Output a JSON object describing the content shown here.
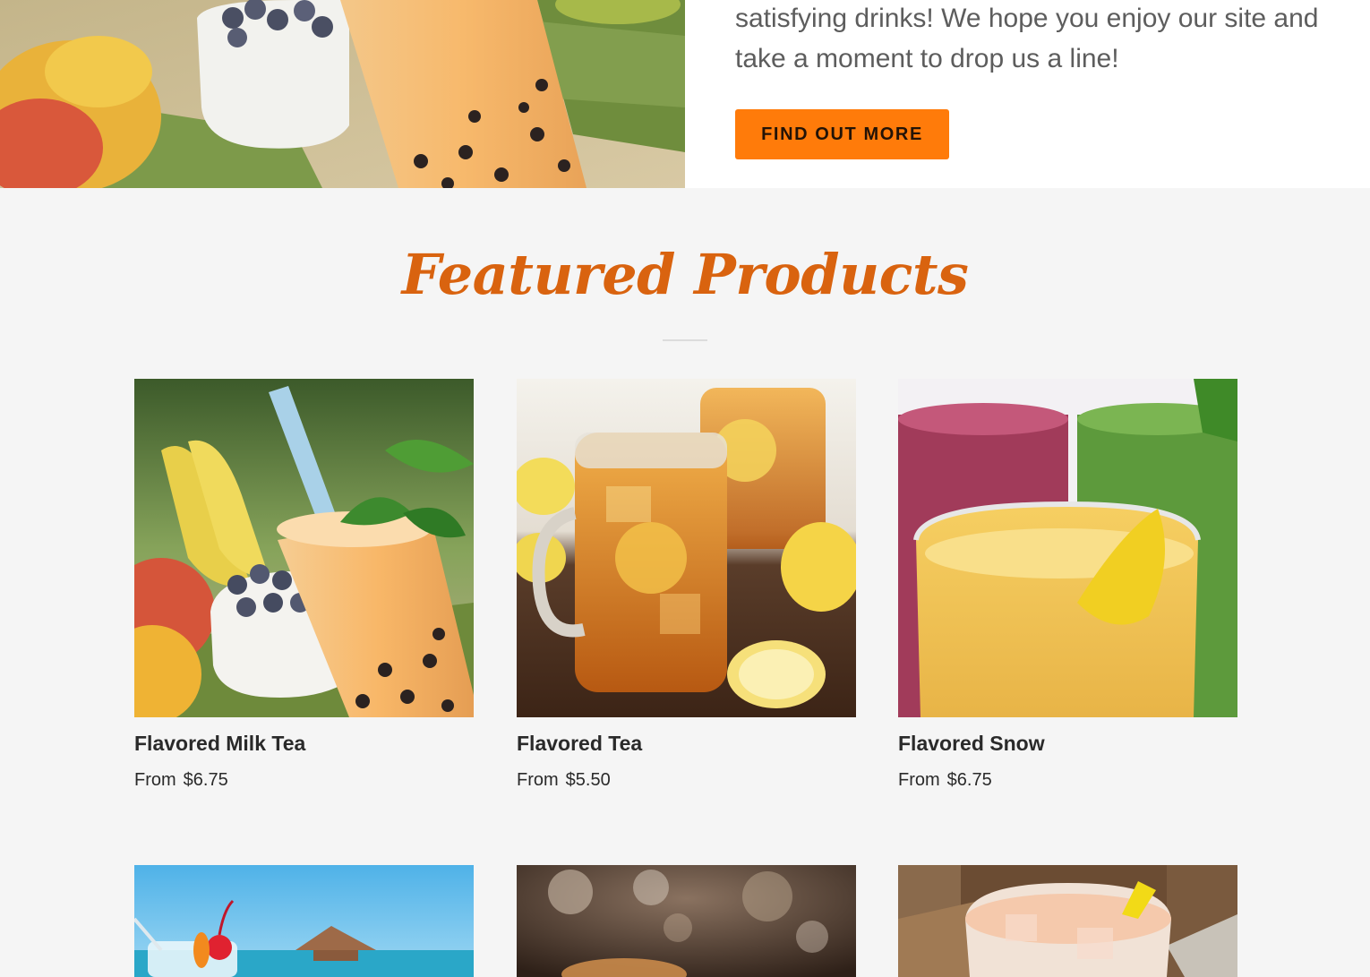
{
  "hero": {
    "copy_line_1": "satisfying drinks! We hope you enjoy our site and",
    "copy_line_2": "take a moment to drop us a line!",
    "cta_label": "FIND OUT MORE",
    "accent_color": "#ff7b0a"
  },
  "featured": {
    "title": "Featured Products",
    "title_color": "#d9630f",
    "products": [
      {
        "name": "Flavored Milk Tea",
        "price_prefix": "From",
        "price": "$6.75",
        "image": "milk-tea-photo"
      },
      {
        "name": "Flavored Tea",
        "price_prefix": "From",
        "price": "$5.50",
        "image": "iced-tea-photo"
      },
      {
        "name": "Flavored Snow",
        "price_prefix": "From",
        "price": "$6.75",
        "image": "smoothie-photo"
      }
    ],
    "more_products_images": [
      "tropical-cocktail-photo",
      "iced-coffee-photo",
      "iced-milk-drink-photo"
    ]
  }
}
